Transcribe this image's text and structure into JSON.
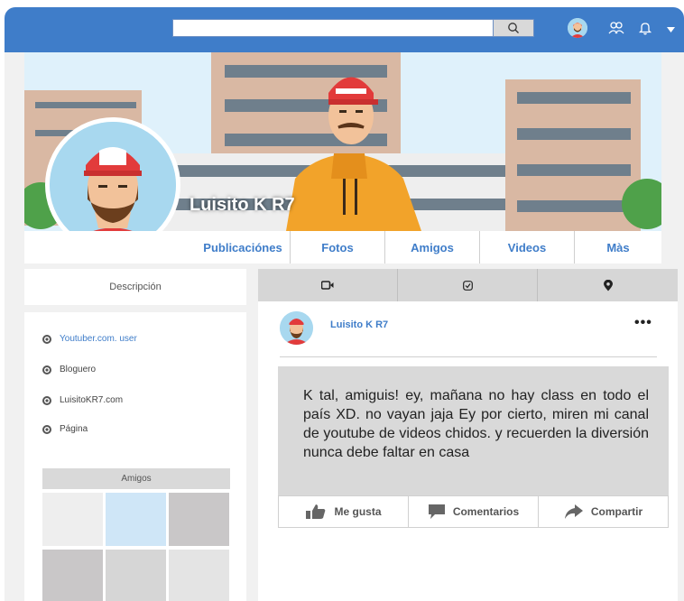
{
  "topbar": {
    "search_placeholder": "",
    "icons": [
      "search-icon",
      "avatar",
      "friends-icon",
      "bell-icon",
      "caret-down-icon"
    ]
  },
  "profile": {
    "name": "Luisito K R7"
  },
  "tabs": [
    {
      "label": "Publicaciónes"
    },
    {
      "label": "Fotos"
    },
    {
      "label": "Amigos"
    },
    {
      "label": "Videos"
    },
    {
      "label": "Màs"
    }
  ],
  "sidebar": {
    "description_label": "Descripción",
    "info": [
      {
        "label": "Youtuber.com. user"
      },
      {
        "label": "Bloguero"
      },
      {
        "label": "LuisitoKR7.com"
      },
      {
        "label": "Página"
      }
    ],
    "friends_label": "Amigos"
  },
  "post_tabs": [
    "video-camera-icon",
    "checkbox-icon",
    "location-pin-icon"
  ],
  "post": {
    "author": "Luisito K R7",
    "menu": "•••",
    "text": "K tal, amiguis! ey, mañana no hay class en todo el país XD. no vayan jaja Ey por cierto, miren mi canal de youtube de videos chidos. y recuerden la diversión nunca debe faltar en casa",
    "actions": [
      {
        "label": "Me gusta",
        "icon": "thumbs-up-icon"
      },
      {
        "label": "Comentarios",
        "icon": "comment-icon"
      },
      {
        "label": "Compartir",
        "icon": "share-icon"
      }
    ]
  },
  "colors": {
    "accent": "#3f7dc9",
    "background": "#f1f1f1",
    "post_body": "#d9d9d9"
  }
}
